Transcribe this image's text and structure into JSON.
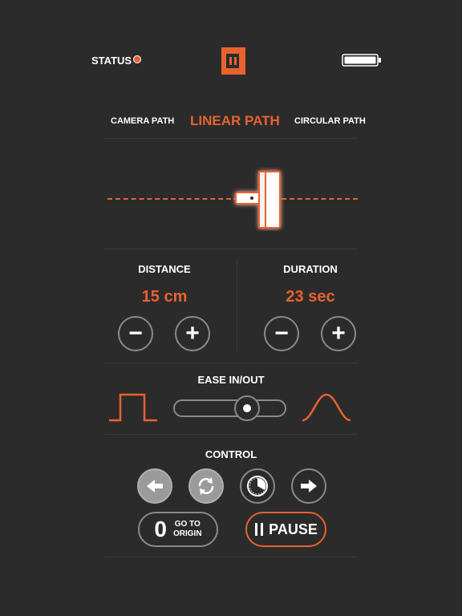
{
  "status": {
    "label": "STATUS",
    "indicator_color": "#e8622f"
  },
  "tabs": [
    {
      "label": "CAMERA PATH",
      "active": false
    },
    {
      "label": "LINEAR PATH",
      "active": true
    },
    {
      "label": "CIRCULAR PATH",
      "active": false
    }
  ],
  "distance": {
    "label": "DISTANCE",
    "value": "15 cm",
    "decrement": "−",
    "increment": "+"
  },
  "duration": {
    "label": "DURATION",
    "value": "23 sec",
    "decrement": "−",
    "increment": "+"
  },
  "ease": {
    "label": "EASE IN/OUT",
    "level": 0.7,
    "left_icon": "square-wave-icon",
    "right_icon": "bell-curve-icon"
  },
  "control": {
    "label": "CONTROL",
    "buttons": [
      "arrow-left-icon",
      "loop-icon",
      "timer-icon",
      "arrow-right-icon"
    ],
    "goto_origin": {
      "number": "0",
      "line1": "GO TO",
      "line2": "ORIGIN"
    },
    "pause": {
      "label": "PAUSE"
    }
  },
  "battery": {
    "level": 1.0
  },
  "colors": {
    "accent": "#e8622f",
    "background": "#2b2b2b",
    "outline": "#8a8a8a"
  }
}
